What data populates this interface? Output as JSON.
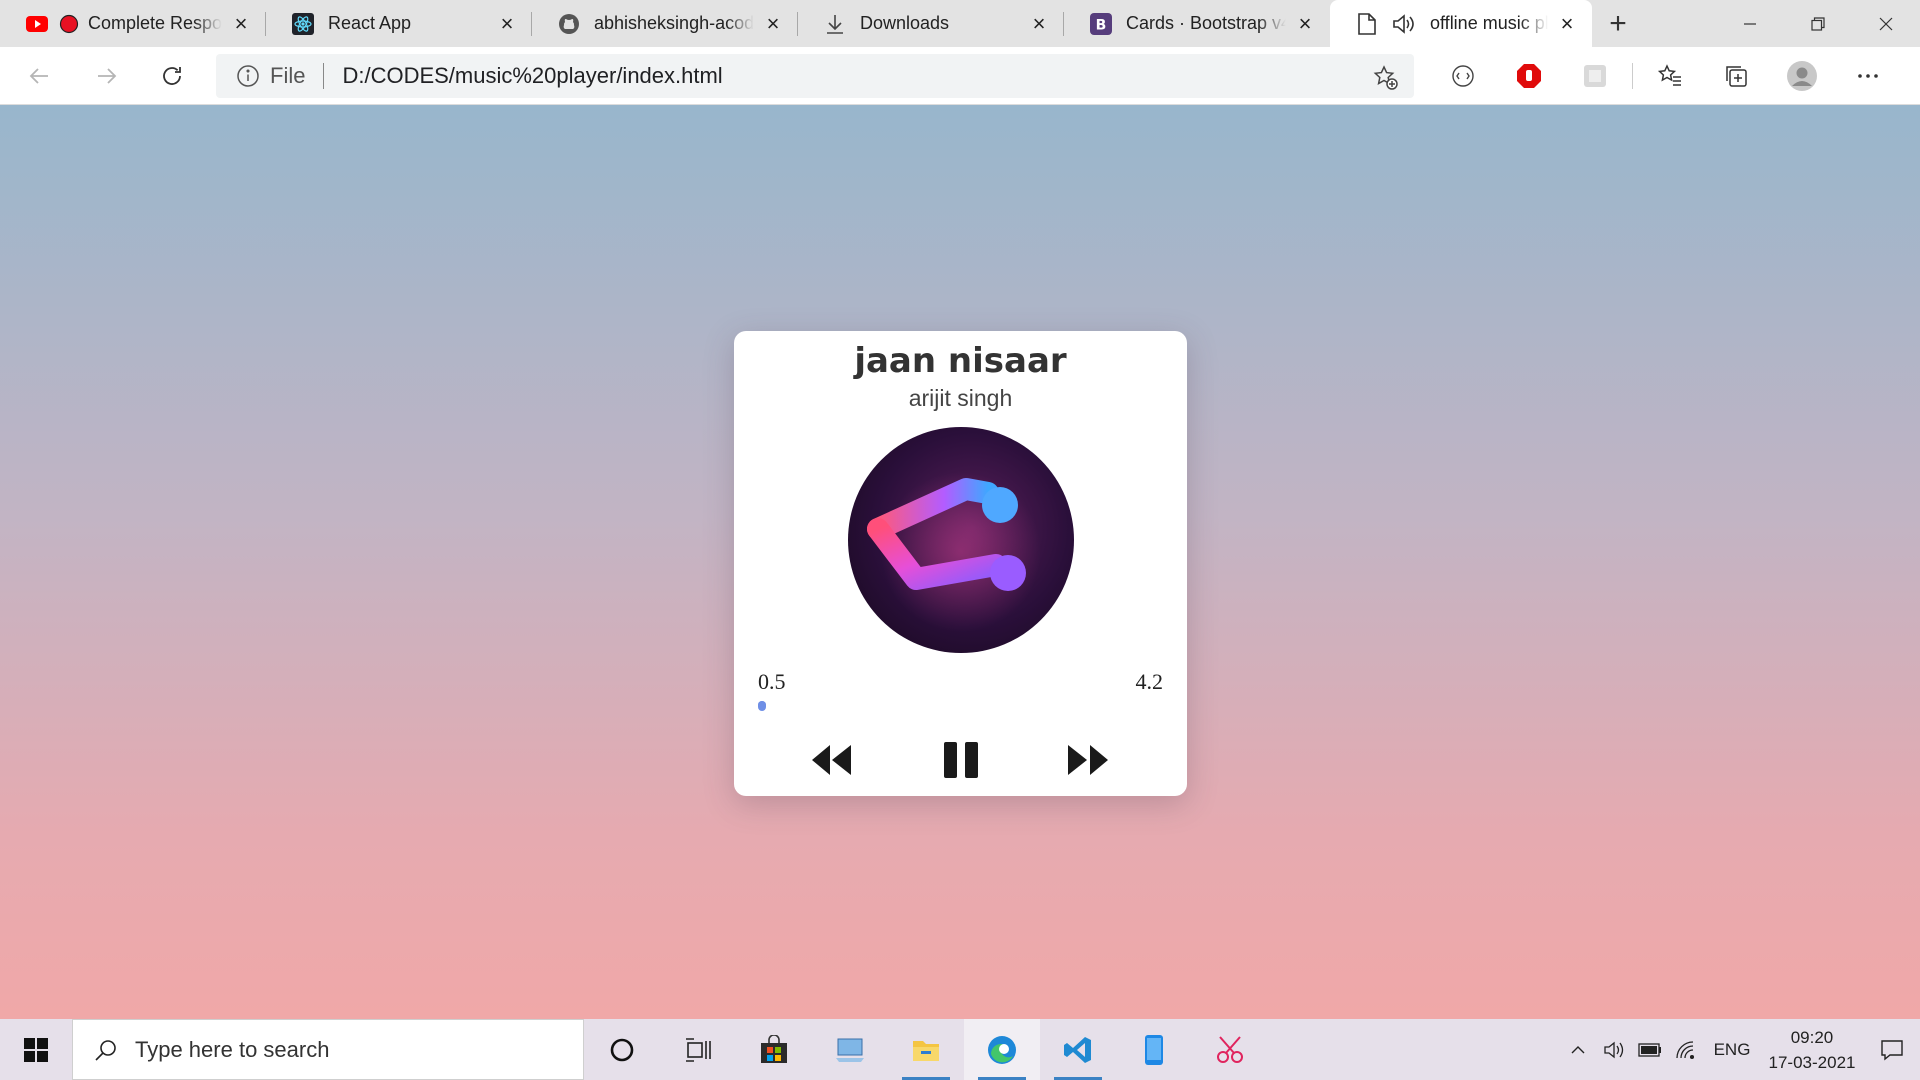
{
  "browser": {
    "tabs": [
      {
        "title": "Complete Respor",
        "favicon": "youtube-icon",
        "recording": true
      },
      {
        "title": "React App",
        "favicon": "react-icon"
      },
      {
        "title": "abhisheksingh-acode",
        "favicon": "github-icon"
      },
      {
        "title": "Downloads",
        "favicon": "download-icon"
      },
      {
        "title": "Cards · Bootstrap v4.",
        "favicon": "bootstrap-icon"
      },
      {
        "title": "offline music pl",
        "favicon": "page-icon",
        "active": true,
        "playing_audio": true
      }
    ],
    "address": {
      "scheme_label": "File",
      "url": "D:/CODES/music%20player/index.html"
    }
  },
  "player": {
    "title": "jaan nisaar",
    "artist": "arijit singh",
    "current_time": "0.5",
    "duration": "4.2",
    "progress": 0.02,
    "state": "playing",
    "accent_color": "#6f8fe6"
  },
  "taskbar": {
    "search_placeholder": "Type here to search",
    "language": "ENG",
    "time": "09:20",
    "date": "17-03-2021"
  }
}
